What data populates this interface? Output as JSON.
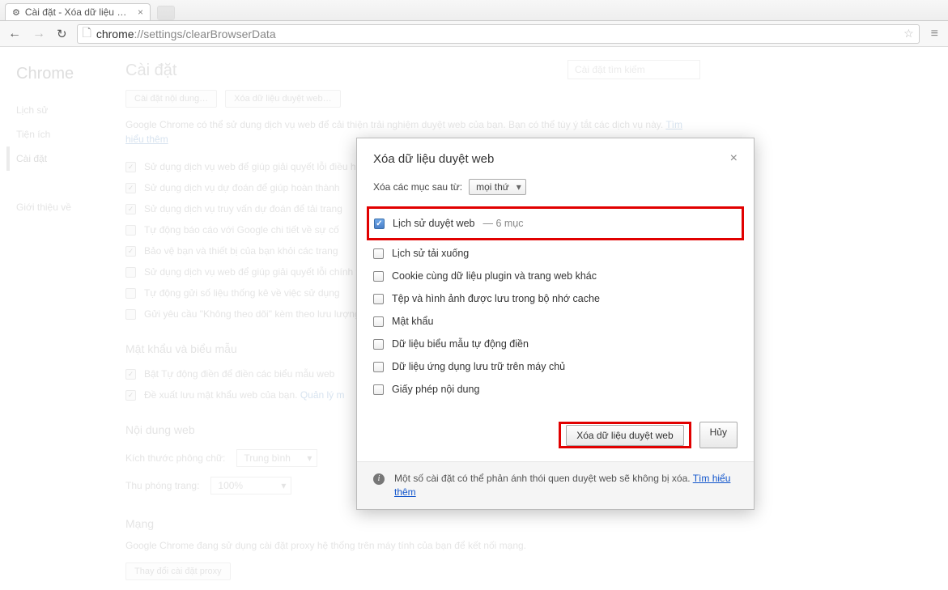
{
  "browser": {
    "tab_title": "Cài đặt - Xóa dữ liệu duyệt w",
    "url_prefix": "chrome",
    "url_path": "://settings/clearBrowserData"
  },
  "sidebar": {
    "brand": "Chrome",
    "items": [
      "Lịch sử",
      "Tiện ích",
      "Cài đặt"
    ],
    "about": "Giới thiệu về"
  },
  "page": {
    "title": "Cài đặt",
    "search_placeholder": "Cài đặt tìm kiếm",
    "btn_content": "Cài đặt nội dung…",
    "btn_clear": "Xóa dữ liệu duyệt web…",
    "desc": "Google Chrome có thể sử dụng dịch vụ web để cải thiện trải nghiệm duyệt web của bạn. Bạn có thể tùy ý tắt các dịch vụ này.",
    "learn_more": "Tìm hiểu thêm",
    "privacy_checks": [
      {
        "checked": true,
        "label": "Sử dụng dịch vụ web để giúp giải quyết lỗi điều hướng"
      },
      {
        "checked": true,
        "label": "Sử dụng dịch vụ dự đoán để giúp hoàn thành"
      },
      {
        "checked": true,
        "label": "Sử dụng dịch vụ truy vấn dự đoán để tải trang"
      },
      {
        "checked": false,
        "label": "Tự động báo cáo với Google chi tiết về sự cố"
      },
      {
        "checked": true,
        "label": "Bảo vệ bạn và thiết bị của bạn khỏi các trang"
      },
      {
        "checked": false,
        "label": "Sử dụng dịch vụ web để giúp giải quyết lỗi chính tả"
      },
      {
        "checked": false,
        "label": "Tự động gửi số liệu thống kê về việc sử dụng"
      },
      {
        "checked": false,
        "label": "Gửi yêu cầu \"Không theo dõi\" kèm theo lưu lượng"
      }
    ],
    "pw_head": "Mật khẩu và biểu mẫu",
    "pw_checks": [
      {
        "checked": true,
        "label": "Bật Tự động điền để điền các biểu mẫu web"
      },
      {
        "checked": true,
        "label": "Đề xuất lưu mật khẩu web của bạn.",
        "link": "Quản lý m"
      }
    ],
    "content_head": "Nội dung web",
    "font_label": "Kích thước phông chữ:",
    "font_value": "Trung bình",
    "zoom_label": "Thu phóng trang:",
    "zoom_value": "100%",
    "net_head": "Mạng",
    "net_desc": "Google Chrome đang sử dụng cài đặt proxy hệ thống trên máy tính của bạn để kết nối mạng.",
    "net_btn": "Thay đổi cài đặt proxy"
  },
  "dialog": {
    "title": "Xóa dữ liệu duyệt web",
    "range_label": "Xóa các mục sau từ:",
    "range_value": "mọi thứ",
    "options": [
      {
        "checked": true,
        "label": "Lịch sử duyệt web",
        "detail": "— 6 mục",
        "highlight": true
      },
      {
        "checked": false,
        "label": "Lịch sử tải xuống"
      },
      {
        "checked": false,
        "label": "Cookie cùng dữ liệu plugin và trang web khác"
      },
      {
        "checked": false,
        "label": "Tệp và hình ảnh được lưu trong bộ nhớ cache"
      },
      {
        "checked": false,
        "label": "Mật khẩu"
      },
      {
        "checked": false,
        "label": "Dữ liệu biểu mẫu tự động điền"
      },
      {
        "checked": false,
        "label": "Dữ liệu ứng dụng lưu trữ trên máy chủ"
      },
      {
        "checked": false,
        "label": "Giấy phép nội dung"
      }
    ],
    "btn_clear": "Xóa dữ liệu duyệt web",
    "btn_cancel": "Hủy",
    "footer_text": "Một số cài đặt có thể phản ánh thói quen duyệt web sẽ không bị xóa.",
    "footer_link": "Tìm hiểu thêm"
  }
}
